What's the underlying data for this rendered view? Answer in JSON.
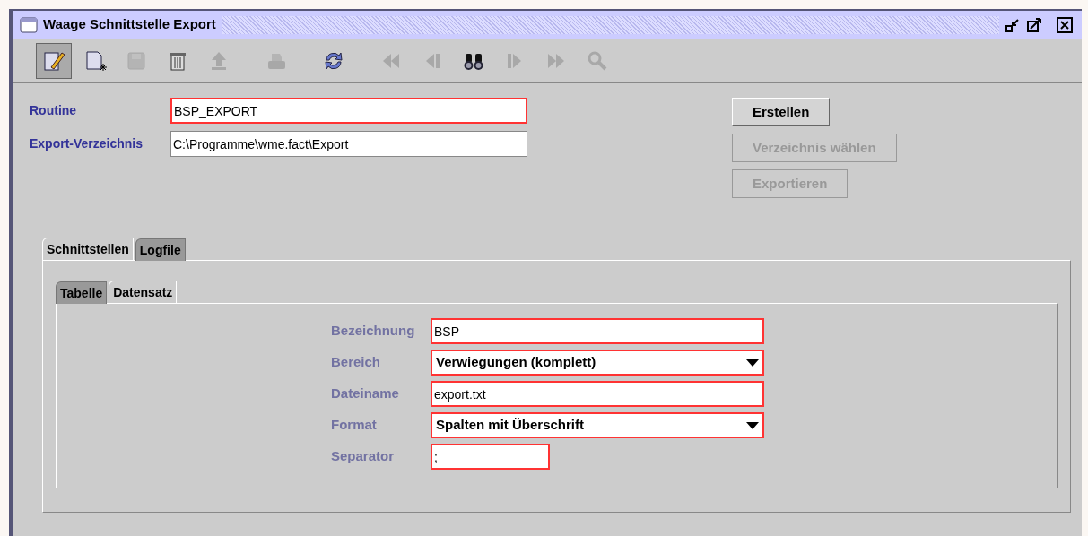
{
  "window": {
    "title": "Waage Schnittstelle Export"
  },
  "toolbar": [
    {
      "kind": "edit",
      "disabled": false,
      "pressed": true
    },
    {
      "kind": "new",
      "disabled": false,
      "pressed": false
    },
    {
      "kind": "save",
      "disabled": true,
      "pressed": false
    },
    {
      "kind": "delete",
      "disabled": false,
      "pressed": false
    },
    {
      "kind": "upload",
      "disabled": true,
      "pressed": false
    },
    {
      "kind": "print",
      "disabled": true,
      "pressed": false
    },
    {
      "kind": "refresh",
      "disabled": false,
      "pressed": false
    },
    {
      "kind": "first",
      "disabled": true,
      "pressed": false
    },
    {
      "kind": "prev",
      "disabled": true,
      "pressed": false
    },
    {
      "kind": "find",
      "disabled": false,
      "pressed": false
    },
    {
      "kind": "next",
      "disabled": true,
      "pressed": false
    },
    {
      "kind": "last",
      "disabled": true,
      "pressed": false
    },
    {
      "kind": "search",
      "disabled": true,
      "pressed": false
    }
  ],
  "header_fields": [
    {
      "label": "Routine",
      "value": "BSP_EXPORT",
      "required": true
    },
    {
      "label": "Export-Verzeichnis",
      "value": "C:\\Programme\\wme.fact\\Export",
      "required": false
    }
  ],
  "buttons": [
    {
      "label": "Erstellen",
      "disabled": false
    },
    {
      "label": "Verzeichnis wählen",
      "disabled": true
    },
    {
      "label": "Exportieren",
      "disabled": true
    }
  ],
  "tabs": [
    {
      "label": "Schnittstellen",
      "selected": true
    },
    {
      "label": "Logfile",
      "selected": false
    }
  ],
  "subtabs": [
    {
      "label": "Tabelle",
      "selected": false
    },
    {
      "label": "Datensatz",
      "selected": true
    }
  ],
  "record_fields": [
    {
      "label": "Bezeichnung",
      "kind": "text",
      "value": "BSP",
      "required": true
    },
    {
      "label": "Bereich",
      "kind": "combo",
      "value": "Verwiegungen (komplett)",
      "required": true
    },
    {
      "label": "Dateiname",
      "kind": "text",
      "value": "export.txt",
      "required": true
    },
    {
      "label": "Format",
      "kind": "combo",
      "value": "Spalten mit Überschrift",
      "required": true
    },
    {
      "label": "Separator",
      "kind": "short",
      "value": ";",
      "required": true
    }
  ]
}
